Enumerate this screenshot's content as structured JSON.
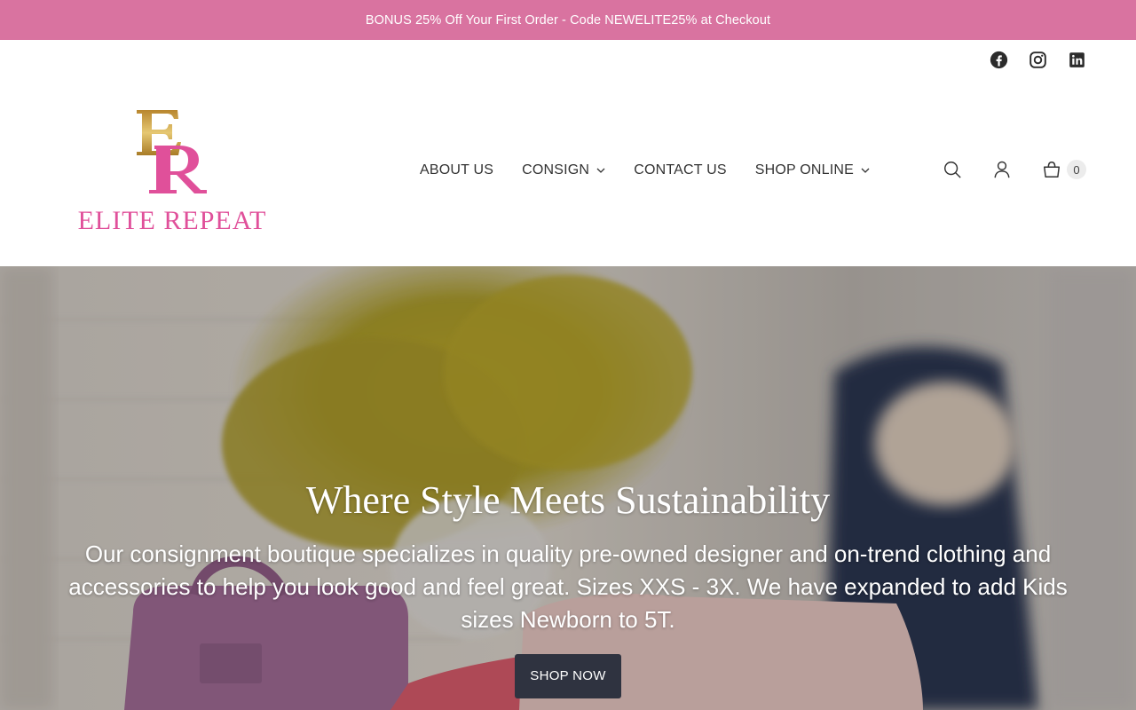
{
  "announcement": {
    "text": "BONUS 25% Off Your First Order - Code NEWELITE25% at Checkout",
    "background": "#d973a0"
  },
  "social": {
    "items": [
      "facebook-icon",
      "instagram-icon",
      "linkedin-icon"
    ]
  },
  "logo": {
    "monogram": "ER",
    "text": "ELITE REPEAT",
    "gold": "#c9a24a",
    "pink": "#e0509a"
  },
  "nav": {
    "items": [
      {
        "label": "ABOUT US",
        "dropdown": false
      },
      {
        "label": "CONSIGN",
        "dropdown": true
      },
      {
        "label": "CONTACT US",
        "dropdown": false
      },
      {
        "label": "SHOP ONLINE",
        "dropdown": true
      }
    ]
  },
  "utility": {
    "cart_count": "0"
  },
  "hero": {
    "title": "Where Style Meets Sustainability",
    "subtitle": "Our consignment boutique specializes in quality pre-owned designer and on-trend clothing and accessories to help you look good and feel great. Sizes XXS - 3X. We have expanded to add Kids sizes Newborn to 5T.",
    "button_label": "SHOP NOW",
    "button_color": "#2f3340"
  }
}
